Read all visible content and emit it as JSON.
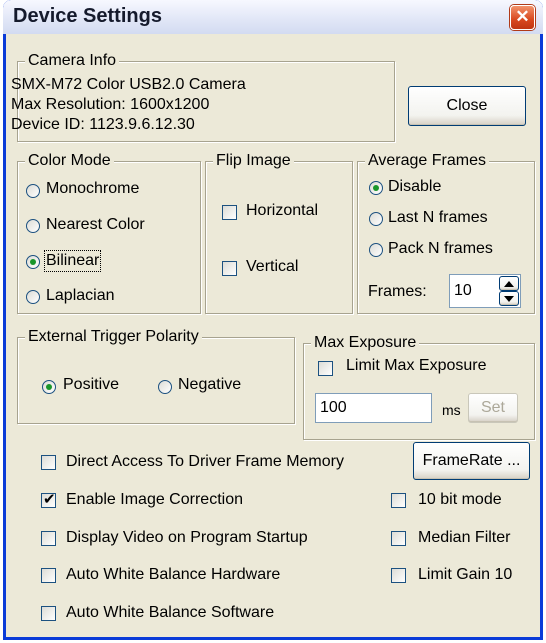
{
  "window": {
    "title": "Device Settings",
    "close_glyph": "✕"
  },
  "camera_info": {
    "legend": "Camera Info",
    "model": "SMX-M72 Color USB2.0 Camera",
    "resolution": "Max Resolution: 1600x1200",
    "device_id": "Device ID: 1123.9.6.12.30"
  },
  "close_button": "Close",
  "color_mode": {
    "legend": "Color Mode",
    "options": [
      "Monochrome",
      "Nearest Color",
      "Bilinear",
      "Laplacian"
    ],
    "selected": "Bilinear"
  },
  "flip_image": {
    "legend": "Flip Image",
    "horizontal": {
      "label": "Horizontal",
      "checked": false
    },
    "vertical": {
      "label": "Vertical",
      "checked": false
    }
  },
  "average_frames": {
    "legend": "Average Frames",
    "options": [
      "Disable",
      "Last N frames",
      "Pack N frames"
    ],
    "selected": "Disable",
    "frames_label": "Frames:",
    "frames_value": "10"
  },
  "trigger": {
    "legend": "External Trigger Polarity",
    "positive": "Positive",
    "negative": "Negative",
    "selected": "Positive"
  },
  "max_exposure": {
    "legend": "Max Exposure",
    "limit_label": "Limit Max Exposure",
    "limit_checked": false,
    "value": "100",
    "unit": "ms",
    "set_button": "Set"
  },
  "options": {
    "direct_access": {
      "label": "Direct Access To Driver Frame Memory",
      "checked": false
    },
    "framerate_button": "FrameRate ...",
    "image_correction": {
      "label": "Enable Image Correction",
      "checked": true
    },
    "ten_bit": {
      "label": "10 bit mode",
      "checked": false
    },
    "display_video": {
      "label": "Display Video on Program Startup",
      "checked": false
    },
    "median_filter": {
      "label": "Median Filter",
      "checked": false
    },
    "awb_hardware": {
      "label": "Auto White Balance Hardware",
      "checked": false
    },
    "limit_gain": {
      "label": "Limit Gain 10",
      "checked": false
    },
    "awb_software": {
      "label": "Auto White Balance Software",
      "checked": false
    }
  }
}
